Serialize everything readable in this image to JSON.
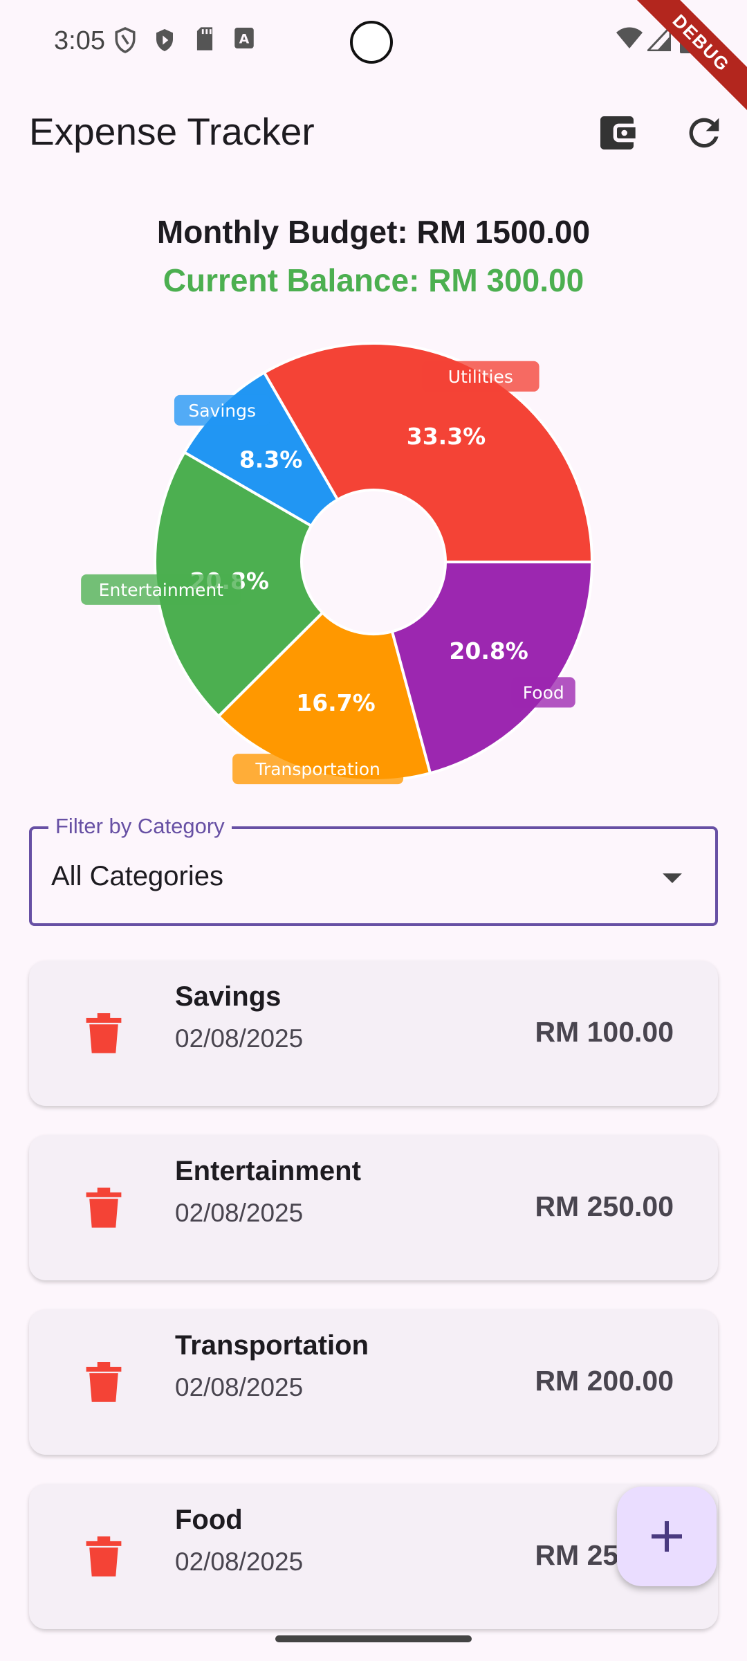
{
  "status_bar": {
    "time": "3:05",
    "icons": [
      "shield-outline-icon",
      "play-protect-icon",
      "sd-card-icon",
      "a-badge-icon",
      "wifi-icon",
      "signal-icon",
      "battery-icon"
    ]
  },
  "debug_banner": "DEBUG",
  "app_bar": {
    "title": "Expense Tracker",
    "actions": [
      "wallet-icon",
      "refresh-icon"
    ]
  },
  "summary": {
    "budget_text": "Monthly Budget: RM 1500.00",
    "balance_text": "Current Balance: RM 300.00",
    "balance_color": "#4caf50"
  },
  "chart_data": {
    "type": "pie",
    "donut": true,
    "categories": [
      "Utilities",
      "Savings",
      "Entertainment",
      "Transportation",
      "Food"
    ],
    "values": [
      33.3,
      8.3,
      20.8,
      16.7,
      20.8
    ],
    "value_labels": [
      "33.3%",
      "8.3%",
      "20.8%",
      "16.7%",
      "20.8%"
    ],
    "colors": [
      "#f44336",
      "#2196f3",
      "#4caf50",
      "#ff9800",
      "#9c27b0"
    ]
  },
  "filter": {
    "label": "Filter by Category",
    "selected": "All Categories"
  },
  "expenses": [
    {
      "category": "Savings",
      "date": "02/08/2025",
      "amount": "RM 100.00"
    },
    {
      "category": "Entertainment",
      "date": "02/08/2025",
      "amount": "RM 250.00"
    },
    {
      "category": "Transportation",
      "date": "02/08/2025",
      "amount": "RM 200.00"
    },
    {
      "category": "Food",
      "date": "02/08/2025",
      "amount": "RM 250.00"
    }
  ],
  "colors": {
    "accent": "#6750a4",
    "delete": "#f44336",
    "fab_bg": "#eaddff"
  },
  "fab_icon": "add-icon"
}
